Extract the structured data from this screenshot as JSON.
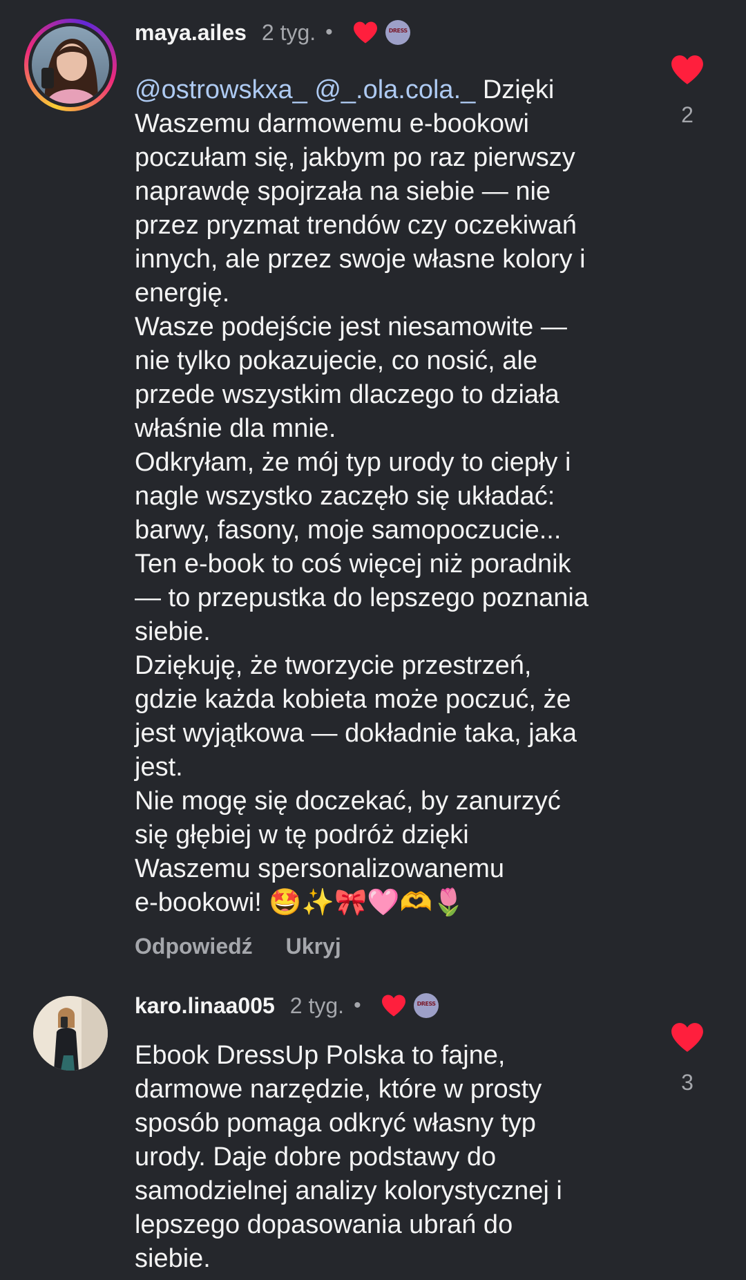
{
  "comments": [
    {
      "username": "maya.ailes",
      "time": "2 tyg.",
      "dot": "•",
      "mentions": "@ostrowskxa_ @_.ola.cola._",
      "lines_after_mention": "Dzięki",
      "lines": [
        "Waszemu darmowemu e-bookowi",
        "poczułam się, jakbym po raz pierwszy",
        "naprawdę spojrzała na siebie — nie",
        "przez pryzmat trendów czy oczekiwań",
        "innych, ale przez swoje własne kolory i",
        "energię.",
        "Wasze podejście jest niesamowite —",
        "nie tylko pokazujecie, co nosić, ale",
        "przede wszystkim dlaczego to działa",
        "właśnie dla mnie.",
        "Odkryłam, że mój typ urody to ciepły i",
        "nagle wszystko zaczęło się układać:",
        "barwy, fasony, moje samopoczucie...",
        "Ten e-book to coś więcej niż poradnik",
        "— to przepustka do lepszego poznania",
        "siebie.",
        "Dziękuję, że tworzycie przestrzeń,",
        "gdzie każda kobieta może poczuć, że",
        "jest wyjątkowa — dokładnie taka, jaka",
        "jest.",
        "Nie mogę się doczekać, by zanurzyć",
        "się głębiej w tę podróż dzięki",
        "Waszemu spersonalizowanemu",
        "e-bookowi! 🤩✨🎀🩷🫶🌷"
      ],
      "reply_label": "Odpowiedź",
      "hide_label": "Ukryj",
      "like_count": "2"
    },
    {
      "username": "karo.linaa005",
      "time": "2 tyg.",
      "dot": "•",
      "lines": [
        "Ebook DressUp Polska to fajne,",
        "darmowe narzędzie, które w prosty",
        "sposób pomaga odkryć własny typ",
        "urody. Daje dobre podstawy do",
        "samodzielnej analizy kolorystycznej i",
        "lepszego dopasowania ubrań do",
        "siebie."
      ],
      "like_count": "3"
    }
  ],
  "colors": {
    "background": "#25272c",
    "text": "#f4f4f4",
    "muted": "#a5a7ac",
    "mention": "#aecaf2",
    "heart": "#ff1f3d"
  },
  "icons": {
    "like": "heart-filled-icon",
    "creator_like": "heart-filled-icon",
    "creator_badge": "creator-avatar-badge"
  }
}
